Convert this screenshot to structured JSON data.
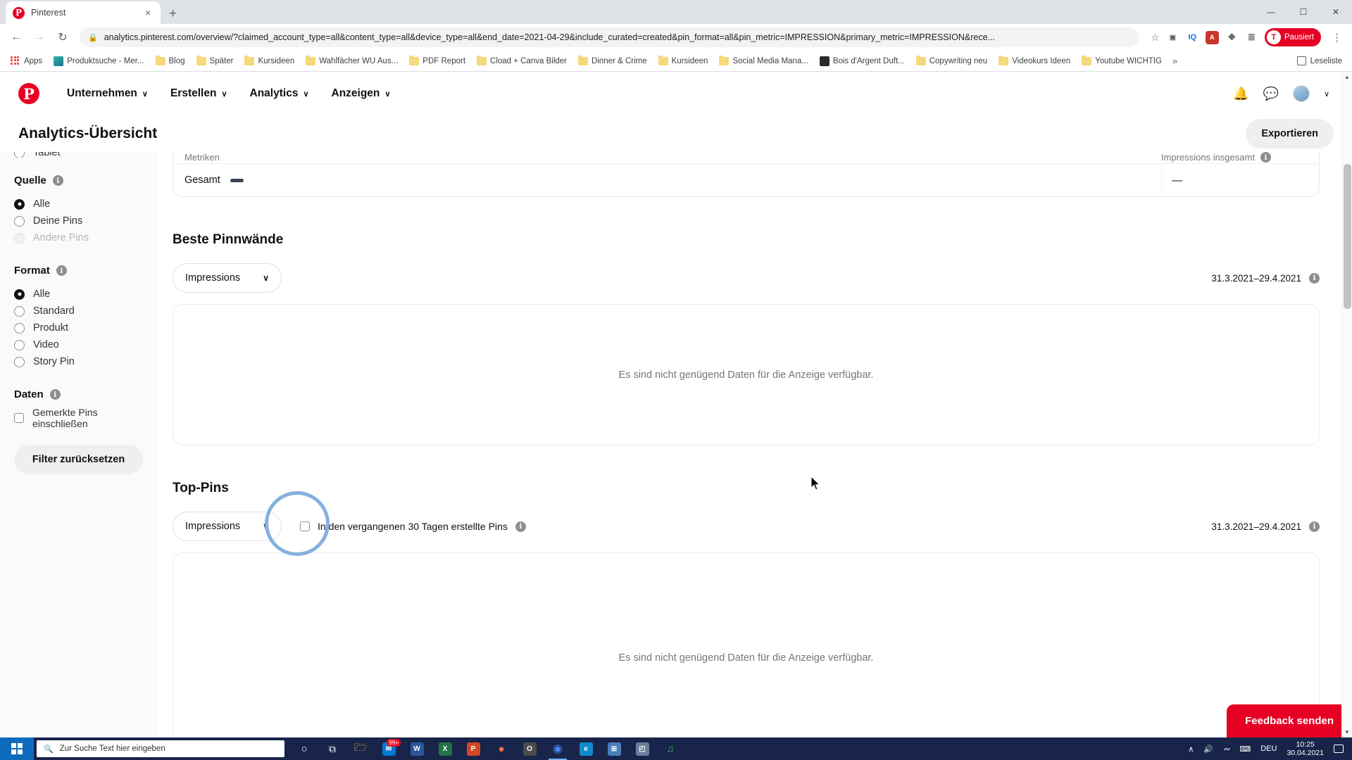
{
  "browser": {
    "tab": {
      "title": "Pinterest",
      "favicon": "pinterest-icon",
      "close": "×"
    },
    "new_tab_label": "+",
    "window_controls": {
      "minimize": "—",
      "maximize": "☐",
      "close": "✕"
    },
    "nav": {
      "back": "←",
      "forward": "→",
      "reload": "↻"
    },
    "omnibox": {
      "lock": "🔒",
      "url": "analytics.pinterest.com/overview/?claimed_account_type=all&content_type=all&device_type=all&end_date=2021-04-29&include_curated=created&pin_format=all&pin_metric=IMPRESSION&primary_metric=IMPRESSION&rece...",
      "star": "☆"
    },
    "extensions": [
      {
        "name": "screencast-extension",
        "glyph": "▣",
        "color": "#5f6368",
        "bg": "transparent"
      },
      {
        "name": "iq-extension",
        "glyph": "IQ",
        "color": "#1a73e8",
        "bg": "transparent"
      },
      {
        "name": "adblock-extension",
        "glyph": "A",
        "color": "#ffffff",
        "bg": "#c9362b"
      },
      {
        "name": "puzzle-extension",
        "glyph": "❖",
        "color": "#5f6368",
        "bg": "transparent"
      },
      {
        "name": "list-extension",
        "glyph": "≣",
        "color": "#5f6368",
        "bg": "transparent"
      }
    ],
    "profile": {
      "initial": "T",
      "label": "Pausiert"
    },
    "menu": "⋮",
    "bookmarks": [
      {
        "label": "Apps",
        "icon": "apps-grid-icon"
      },
      {
        "label": "Produktsuche - Mer...",
        "icon": "image-icon"
      },
      {
        "label": "Blog",
        "icon": "folder-icon"
      },
      {
        "label": "Später",
        "icon": "folder-icon"
      },
      {
        "label": "Kursideen",
        "icon": "folder-icon"
      },
      {
        "label": "Wahlfächer WU Aus...",
        "icon": "folder-icon"
      },
      {
        "label": "PDF Report",
        "icon": "folder-icon"
      },
      {
        "label": "Cload + Canva Bilder",
        "icon": "folder-icon"
      },
      {
        "label": "Dinner & Crime",
        "icon": "folder-icon"
      },
      {
        "label": "Kursideen",
        "icon": "folder-icon"
      },
      {
        "label": "Social Media Mana...",
        "icon": "folder-icon"
      },
      {
        "label": "Bois d'Argent Duft...",
        "icon": "image-icon"
      },
      {
        "label": "Copywriting neu",
        "icon": "folder-icon"
      },
      {
        "label": "Videokurs Ideen",
        "icon": "folder-icon"
      },
      {
        "label": "Youtube WICHTIG",
        "icon": "folder-icon"
      }
    ],
    "bookmarks_overflow": "»",
    "reading_list": "Leseliste"
  },
  "app": {
    "logo": "P",
    "nav": [
      {
        "label": "Unternehmen",
        "chevron": "∨"
      },
      {
        "label": "Erstellen",
        "chevron": "∨"
      },
      {
        "label": "Analytics",
        "chevron": "∨"
      },
      {
        "label": "Anzeigen",
        "chevron": "∨"
      }
    ],
    "header_icons": {
      "notifications": "🔔",
      "messages": "💬",
      "avatar": "user-avatar",
      "account_chevron": "∨"
    },
    "page_title": "Analytics-Übersicht",
    "export_button": "Exportieren"
  },
  "sidebar": {
    "clipped_item": {
      "label": "Tablet"
    },
    "sections": [
      {
        "title": "Quelle",
        "info": "i",
        "options": [
          {
            "label": "Alle",
            "selected": true,
            "disabled": false
          },
          {
            "label": "Deine Pins",
            "selected": false,
            "disabled": false
          },
          {
            "label": "Andere Pins",
            "selected": false,
            "disabled": true
          }
        ]
      },
      {
        "title": "Format",
        "info": "i",
        "options": [
          {
            "label": "Alle",
            "selected": true,
            "disabled": false
          },
          {
            "label": "Standard",
            "selected": false,
            "disabled": false
          },
          {
            "label": "Produkt",
            "selected": false,
            "disabled": false
          },
          {
            "label": "Video",
            "selected": false,
            "disabled": false
          },
          {
            "label": "Story Pin",
            "selected": false,
            "disabled": false
          }
        ]
      }
    ],
    "data_section": {
      "title": "Daten",
      "info": "i",
      "checkbox": {
        "label": "Gemerkte Pins einschließen",
        "checked": false
      }
    },
    "reset_button": "Filter zurücksetzen"
  },
  "main": {
    "table_tail": {
      "col_metric_header": "Metriken",
      "col_value_header": "Impressions insgesamt",
      "header_info": "i",
      "row_label": "Gesamt",
      "row_value": "—"
    },
    "sections": [
      {
        "id": "beste-pinnwaende",
        "title": "Beste Pinnwände",
        "metric_select": {
          "value": "Impressions",
          "chevron": "∨"
        },
        "date_range": "31.3.2021–29.4.2021",
        "date_info": "i",
        "empty_message": "Es sind nicht genügend Daten für die Anzeige verfügbar."
      },
      {
        "id": "top-pins",
        "title": "Top-Pins",
        "metric_select": {
          "value": "Impressions",
          "chevron": "∨"
        },
        "checkbox": {
          "label": "In den vergangenen 30 Tagen erstellte Pins",
          "checked": false,
          "info": "i"
        },
        "date_range": "31.3.2021–29.4.2021",
        "date_info": "i",
        "empty_message": "Es sind nicht genügend Daten für die Anzeige verfügbar."
      }
    ],
    "feedback_button": "Feedback senden",
    "highlight_annotation": "dropdown-highlight-circle"
  },
  "taskbar": {
    "start": "windows-start-icon",
    "search_placeholder": "Zur Suche Text hier eingeben",
    "search_icon": "🔍",
    "items": [
      {
        "name": "cortana-icon",
        "glyph": "○",
        "color": "#ffffff",
        "bg": "transparent",
        "badge": ""
      },
      {
        "name": "task-view-icon",
        "glyph": "⧉",
        "color": "#ffffff",
        "bg": "transparent",
        "badge": ""
      },
      {
        "name": "file-explorer-icon",
        "glyph": "📁",
        "color": "#ffc83d",
        "bg": "transparent",
        "badge": ""
      },
      {
        "name": "mail-icon",
        "glyph": "✉",
        "color": "#ffffff",
        "bg": "#0078d4",
        "badge": "99+"
      },
      {
        "name": "word-icon",
        "glyph": "W",
        "color": "#ffffff",
        "bg": "#2b579a",
        "badge": ""
      },
      {
        "name": "excel-icon",
        "glyph": "X",
        "color": "#ffffff",
        "bg": "#217346",
        "badge": ""
      },
      {
        "name": "powerpoint-icon",
        "glyph": "P",
        "color": "#ffffff",
        "bg": "#d24726",
        "badge": ""
      },
      {
        "name": "firefox-icon",
        "glyph": "●",
        "color": "#ff7139",
        "bg": "transparent",
        "badge": ""
      },
      {
        "name": "opera-icon",
        "glyph": "O",
        "color": "#ffffff",
        "bg": "#4b4b4b",
        "badge": ""
      },
      {
        "name": "chrome-icon",
        "glyph": "◉",
        "color": "#4285f4",
        "bg": "transparent",
        "badge": ""
      },
      {
        "name": "edge-icon",
        "glyph": "e",
        "color": "#ffffff",
        "bg": "#0f8bcd",
        "badge": ""
      },
      {
        "name": "store-icon",
        "glyph": "⊞",
        "color": "#ffffff",
        "bg": "#4a7ebb",
        "badge": ""
      },
      {
        "name": "photos-icon",
        "glyph": "◰",
        "color": "#ffffff",
        "bg": "#6a7f99",
        "badge": ""
      },
      {
        "name": "spotify-icon",
        "glyph": "♫",
        "color": "#1db954",
        "bg": "transparent",
        "badge": ""
      }
    ],
    "tray": {
      "chevron": "∧",
      "volume": "🔊",
      "wifi": "",
      "keyboard": "⌨",
      "language": "DEU"
    },
    "clock": {
      "time": "10:25",
      "date": "30.04.2021"
    },
    "action_center": "notification-icon"
  },
  "colors": {
    "pinterest_red": "#e60023",
    "highlight_blue": "#84b1dd",
    "taskbar": "#18244a",
    "sidebar_bg": "#fafafa"
  }
}
